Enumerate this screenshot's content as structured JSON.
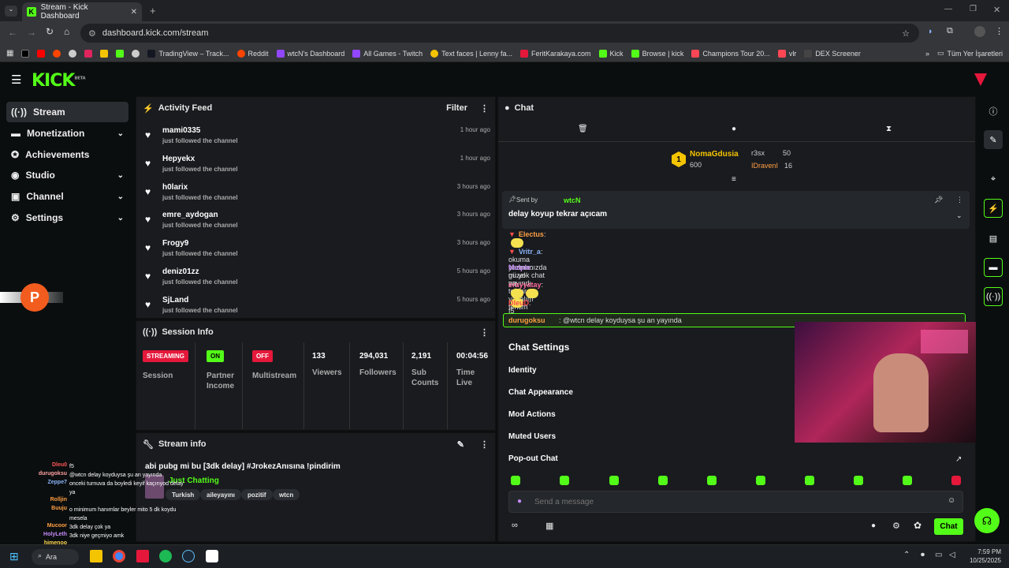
{
  "browser": {
    "tab_title": "Stream - Kick Dashboard",
    "url": "dashboard.kick.com/stream",
    "bookmarks": [
      "TradingView – Track...",
      "Reddit",
      "wtcN's Dashboard",
      "All Games - Twitch",
      "Text faces | Lenny fa...",
      "FeritKarakaya.com",
      "Kick",
      "Browse | kick",
      "Champions Tour 20...",
      "vlr",
      "DEX Screener"
    ],
    "all_bookmarks": "Tüm Yer İşaretleri"
  },
  "logo": "KICK",
  "logo_beta": "BETA",
  "sidebar": {
    "items": [
      {
        "label": "Stream",
        "icon": "stream-icon",
        "active": true
      },
      {
        "label": "Monetization",
        "icon": "money-icon",
        "chevron": true
      },
      {
        "label": "Achievements",
        "icon": "trophy-icon"
      },
      {
        "label": "Studio",
        "icon": "studio-icon",
        "chevron": true
      },
      {
        "label": "Channel",
        "icon": "channel-icon",
        "chevron": true
      },
      {
        "label": "Settings",
        "icon": "gear-icon",
        "chevron": true
      }
    ]
  },
  "activity": {
    "title": "Activity Feed",
    "filter": "Filter",
    "items": [
      {
        "name": "mami0335",
        "action": "just followed the channel",
        "time": "1 hour ago"
      },
      {
        "name": "Hepyekx",
        "action": "just followed the channel",
        "time": "1 hour ago"
      },
      {
        "name": "h0larix",
        "action": "just followed the channel",
        "time": "3 hours ago"
      },
      {
        "name": "emre_aydogan",
        "action": "just followed the channel",
        "time": "3 hours ago"
      },
      {
        "name": "Frogy9",
        "action": "just followed the channel",
        "time": "3 hours ago"
      },
      {
        "name": "deniz01zz",
        "action": "just followed the channel",
        "time": "5 hours ago"
      },
      {
        "name": "SjLand",
        "action": "just followed the channel",
        "time": "5 hours ago"
      }
    ]
  },
  "session": {
    "title": "Session Info",
    "streaming": "STREAMING",
    "session_label": "Session",
    "partner_status": "ON",
    "partner_label": "Partner Income",
    "multistream_status": "OFF",
    "multistream_label": "Multistream",
    "viewers": "133",
    "viewers_label": "Viewers",
    "followers": "294,031",
    "followers_label": "Followers",
    "subs": "2,191",
    "subs_label": "Sub Counts",
    "time": "00:04:56",
    "time_label": "Time Live"
  },
  "stream_info": {
    "title": "Stream info",
    "stream_title": "abi pubg mi bu [3dk delay] #JrokezAnısına !pindirim",
    "category": "Just Chatting",
    "tags": [
      "Turkish",
      "aileyayını",
      "pozitif",
      "wtcn"
    ]
  },
  "chat": {
    "title": "Chat",
    "top": [
      {
        "rank": "1",
        "name": "NomaGdusia",
        "value": "600"
      },
      {
        "name": "r3sx",
        "value": "50"
      },
      {
        "name": "IDravenI",
        "value": "16"
      }
    ],
    "pinned_sent_by": "Sent by",
    "pinned_user": "wtcN",
    "pinned_message": "delay koyup tekrar açıcam",
    "messages": [
      {
        "user": "Electus",
        "text": ":",
        "color": "#ff9f43"
      },
      {
        "user": "Vritr_a",
        "text": ": okuma yazmanızda mı yok chat aq",
        "color": "#8ab4f8"
      },
      {
        "user": "Malple",
        "text": ": güzel yayındı tekrar yapalım feritim",
        "color": "#c58af9"
      },
      {
        "user": "erayyatay",
        "text": ":",
        "color": "#ff6b9a"
      },
      {
        "user": "DleuD",
        "text": ": f5",
        "color": "#ff4d4d"
      }
    ],
    "highlight_user": "durugoksu",
    "highlight_text": ": @wtcn delay koyduysa şu an yayında",
    "settings_title": "Chat Settings",
    "settings_items": [
      "Identity",
      "Chat Appearance",
      "Mod Actions",
      "Muted Users",
      "Pop-out Chat"
    ],
    "input_placeholder": "Send a message",
    "send_label": "Chat"
  },
  "overlay_chat": [
    {
      "user": "Dleu0",
      "text": "f5",
      "color": "#ff5555"
    },
    {
      "user": "durugoksu",
      "text": "@wtcn delay koyduysa şu an yayında",
      "color": "#ff9f9f"
    },
    {
      "user": "Zeppe7",
      "text": "onceki turnuva da boyledi keyif kaçırıyod delay ya",
      "color": "#8ab4f8"
    },
    {
      "user": "Rolljin",
      "text": "",
      "color": "#ff9f43"
    },
    {
      "user": "Buuju",
      "text": "o minimum hanımlar beyler mito 5 dk koydu mesela",
      "color": "#ff9f43"
    },
    {
      "user": "Mucoor",
      "text": "3dk delay çok ya",
      "color": "#ff9f43"
    },
    {
      "user": "HolyLeth",
      "text": "3dk niye geçmiyo amk",
      "color": "#c58af9"
    },
    {
      "user": "himenoo",
      "text": "",
      "color": "#ffd84d"
    }
  ],
  "taskbar": {
    "search": "Ara",
    "time": "7:59 PM",
    "date": "10/25/2025"
  },
  "colors": {
    "accent": "#53fc18",
    "streaming": "#e5183b",
    "panel": "#191b1f"
  }
}
